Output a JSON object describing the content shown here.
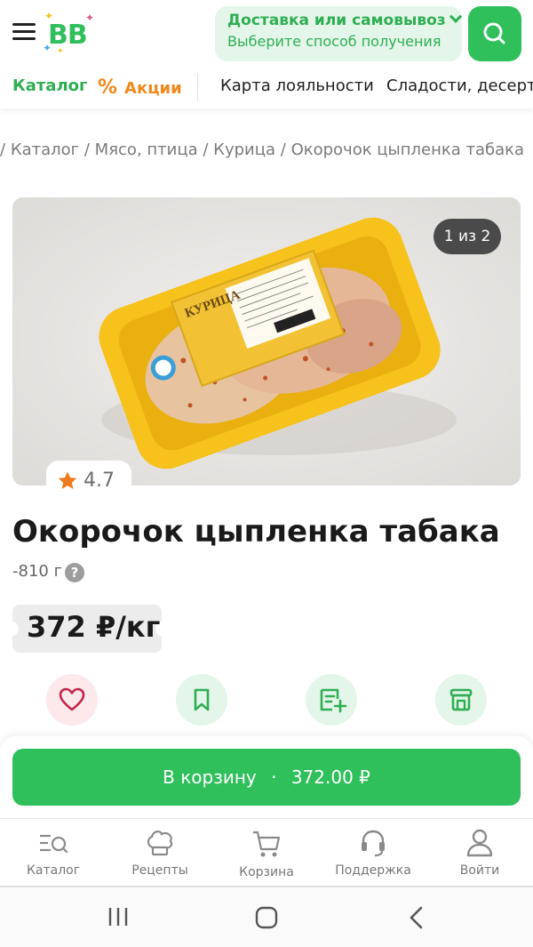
{
  "header": {
    "logo_text": "BB",
    "delivery_title": "Доставка или самовывоз",
    "delivery_subtitle": "Выберите способ получения"
  },
  "nav": {
    "items": [
      {
        "label": "Каталог",
        "style": "green"
      },
      {
        "label": "Акции",
        "style": "orange",
        "icon": "percent-icon"
      },
      {
        "label": "Карта лояльности",
        "style": "dark"
      },
      {
        "label": "Сладости, десерты",
        "style": "dark"
      }
    ]
  },
  "breadcrumb": {
    "items": [
      "Каталог",
      "Мясо, птица",
      "Курица",
      "Окорочок цыпленка табака"
    ],
    "separator": "/"
  },
  "gallery": {
    "counter": "1 из 2",
    "package_label": "КУРИЦА"
  },
  "product": {
    "rating": "4.7",
    "title": "Окорочок цыпленка табака",
    "weight": "-810 г",
    "help_symbol": "?",
    "price": "372 ₽/кг"
  },
  "actions": [
    {
      "name": "favorite-button",
      "icon": "heart-icon"
    },
    {
      "name": "bookmark-button",
      "icon": "bookmark-icon"
    },
    {
      "name": "add-to-list-button",
      "icon": "list-add-icon"
    },
    {
      "name": "store-availability-button",
      "icon": "store-icon"
    }
  ],
  "cart": {
    "label": "В корзину",
    "dot": "·",
    "price": "372.00 ₽"
  },
  "tabbar": {
    "items": [
      {
        "label": "Каталог",
        "icon": "catalog-search-icon"
      },
      {
        "label": "Рецепты",
        "icon": "chef-hat-icon"
      },
      {
        "label": "Корзина",
        "icon": "cart-icon"
      },
      {
        "label": "Поддержка",
        "icon": "headset-icon"
      },
      {
        "label": "Войти",
        "icon": "user-icon"
      }
    ]
  },
  "colors": {
    "brand_green": "#2fbf5b",
    "promo_orange": "#f08a1c",
    "light_green_bg": "#e4f6e9",
    "favorite_pink_bg": "#fde8ec"
  }
}
